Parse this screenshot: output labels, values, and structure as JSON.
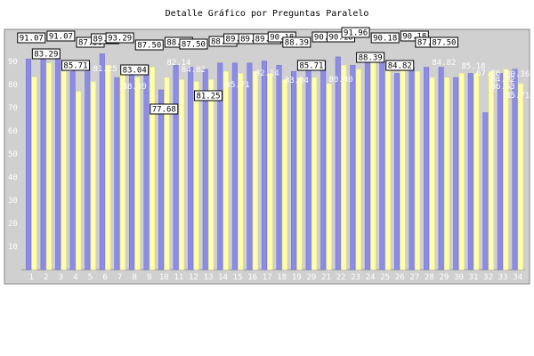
{
  "chart_data": {
    "type": "bar",
    "title": "Detalle Gráfico por Preguntas Paralelo",
    "xlabel": "",
    "ylabel": "",
    "ylim": [
      0,
      100
    ],
    "yticks": [
      0,
      10,
      20,
      30,
      40,
      50,
      60,
      70,
      80,
      90
    ],
    "grid": false,
    "colors": {
      "bg": "#d0d0d0",
      "series1": "#8c8ce6",
      "series2": "#ffffaa",
      "label_box": "#ffffff"
    },
    "categories": [
      "1",
      "2",
      "3",
      "4",
      "5",
      "6",
      "7",
      "8",
      "9",
      "10",
      "11",
      "12",
      "13",
      "14",
      "15",
      "16",
      "17",
      "18",
      "19",
      "20",
      "21",
      "22",
      "23",
      "24",
      "25",
      "26",
      "27",
      "28",
      "29",
      "30",
      "31",
      "32",
      "33",
      "34"
    ],
    "series": [
      {
        "values": [
          91.07,
          91.07,
          91.07,
          87.5,
          89.29,
          93.29,
          83.04,
          87.5,
          87.5,
          77.68,
          88.39,
          87.5,
          86.61,
          89.29,
          89.29,
          89.29,
          90.18,
          88.39,
          85.71,
          90.18,
          90.18,
          91.96,
          88.39,
          90.18,
          90.18,
          84.82,
          87.5,
          87.5,
          87.5,
          83.04,
          84.82,
          67.86,
          84.82,
          86.61
        ]
      },
      {
        "values": [
          83.29,
          89.29,
          85.71,
          76.97,
          81.25,
          88.39,
          85.71,
          83.04,
          87.5,
          83.04,
          82.14,
          81.25,
          82.14,
          85.71,
          84.82,
          85.71,
          84.82,
          82.14,
          83.04,
          83.04,
          80.4,
          88.39,
          86.61,
          90.18,
          88.39,
          86.61,
          85.71,
          83.04,
          83.04,
          84.82,
          84.82,
          85.71,
          86.63,
          80.36
        ]
      }
    ],
    "callouts": [
      "91.07",
      "83.29",
      "91.07",
      "85.71",
      "87.50",
      "89.29",
      "93.29",
      "83.04",
      "87.50",
      "77.68",
      "88.39",
      "87.50",
      "81.25",
      "88.39",
      "89.29",
      "89.29",
      "89.29",
      "90.18",
      "88.39",
      "85.71",
      "90.18",
      "90.18",
      "91.96",
      "88.39",
      "90.18",
      "84.82",
      "90.18",
      "87.50",
      "87.50"
    ],
    "data_labels": [
      "76.97",
      "81.25",
      "88.39",
      "82.14",
      "84.82",
      "85.71",
      "82.14",
      "80.40",
      "83.04",
      "84.82",
      "85.18",
      "67.86",
      "84.82",
      "86.63",
      "85.71",
      "80.36"
    ]
  }
}
